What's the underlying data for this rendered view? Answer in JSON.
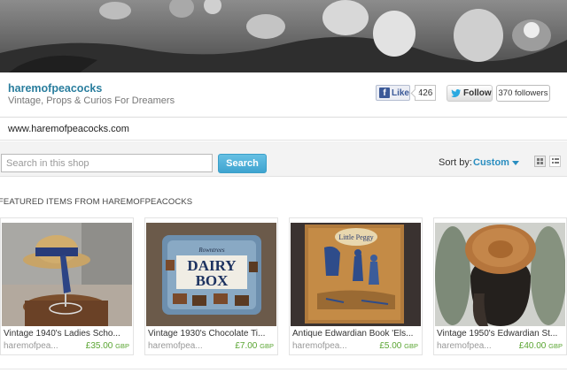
{
  "shop": {
    "name": "haremofpeacocks",
    "tagline": "Vintage, Props & Curios For Dreamers",
    "url": "www.haremofpeacocks.com"
  },
  "social": {
    "fb_icon": "f",
    "fb_like_label": "Like",
    "fb_like_count": "426",
    "tw_follow_label": "Follow",
    "tw_followers": "370 followers"
  },
  "search": {
    "placeholder": "Search in this shop",
    "button_label": "Search"
  },
  "sort": {
    "label": "Sort by:",
    "value": "Custom"
  },
  "featured": {
    "heading": "FEATURED ITEMS FROM HAREMOFPEACOCKS",
    "items": [
      {
        "title": "Vintage 1940's Ladies Scho...",
        "seller": "haremofpea...",
        "price": "£35.00",
        "currency": "GBP"
      },
      {
        "title": "Vintage 1930's Chocolate Ti...",
        "seller": "haremofpea...",
        "price": "£7.00",
        "currency": "GBP"
      },
      {
        "title": "Antique Edwardian Book 'Els...",
        "seller": "haremofpea...",
        "price": "£5.00",
        "currency": "GBP"
      },
      {
        "title": "Vintage 1950's Edwardian St...",
        "seller": "haremofpea...",
        "price": "£40.00",
        "currency": "GBP"
      }
    ],
    "tin_text_small": "Rowntrees",
    "tin_text_line1": "DAIRY",
    "tin_text_line2": "BOX",
    "book_text": "Little Peggy"
  },
  "colors": {
    "shop_name": "#2a7e9e",
    "search_button": "#3fa4d0",
    "sort_value": "#2a8ec0",
    "price": "#5aa532",
    "fb_blue": "#3b5998",
    "twitter_blue": "#2aa9e0"
  }
}
